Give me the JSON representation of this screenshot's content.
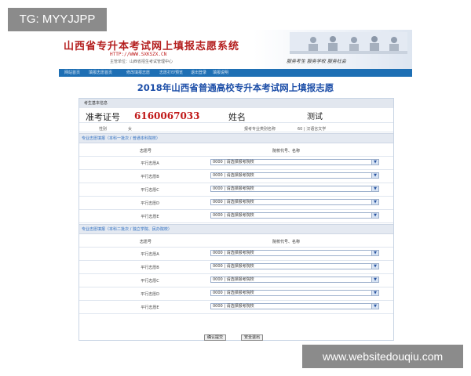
{
  "watermark": {
    "top": "TG: MYYJJPP",
    "bottom": "www.websitedouqiu.com"
  },
  "banner": {
    "title": "山西省专升本考试网上填报志愿系统",
    "url": "HTTP://WWW.SXKSZX.CN",
    "org": "主管单位：山西省招生考试管理中心",
    "slogan": "服务考生  服务学校  服务社会"
  },
  "nav": {
    "items": [
      "网站首页",
      "填报志愿首页",
      "修改填报志愿",
      "志愿打印预览",
      "退出登录",
      "填报说明"
    ]
  },
  "page": {
    "title": "2018年山西省普通高校专升本考试网上填报志愿"
  },
  "candidate": {
    "section_label": "考生基本信息",
    "exam_no_label": "准考证号",
    "exam_no_value": "6160067033",
    "name_label": "姓名",
    "name_value": "测试",
    "gender_label": "性别",
    "gender_value": "女",
    "subject_label": "报考专业类别名称",
    "subject_value": "60 | 汉语言文学"
  },
  "group1": {
    "header": "专业志愿填报（本科一批次 / 普通本科院校）",
    "col_no": "志愿号",
    "col_school": "院校代号、名称",
    "rows": [
      {
        "label": "平行志愿A",
        "value": "0000 | 请选择报考院校"
      },
      {
        "label": "平行志愿B",
        "value": "0000 | 请选择报考院校"
      },
      {
        "label": "平行志愿C",
        "value": "0000 | 请选择报考院校"
      },
      {
        "label": "平行志愿D",
        "value": "0000 | 请选择报考院校"
      },
      {
        "label": "平行志愿E",
        "value": "0000 | 请选择报考院校"
      }
    ]
  },
  "group2": {
    "header": "专业志愿填报（本科二批次 / 独立学院、民办院校）",
    "col_no": "志愿号",
    "col_school": "院校代号、名称",
    "rows": [
      {
        "label": "平行志愿A",
        "value": "0000 | 请选择报考院校"
      },
      {
        "label": "平行志愿B",
        "value": "0000 | 请选择报考院校"
      },
      {
        "label": "平行志愿C",
        "value": "0000 | 请选择报考院校"
      },
      {
        "label": "平行志愿D",
        "value": "0000 | 请选择报考院校"
      },
      {
        "label": "平行志愿E",
        "value": "0000 | 请选择报考院校"
      }
    ]
  },
  "actions": {
    "submit": "确认提交",
    "logout": "安全退出"
  },
  "icons": {
    "dropdown": "chevron-down-icon"
  },
  "colors": {
    "nav_blue": "#1e6fb4",
    "title_blue": "#1c4ea8",
    "banner_red": "#b41e1e",
    "exam_no_red": "#c01818",
    "section_blue": "#2c6dc0"
  }
}
